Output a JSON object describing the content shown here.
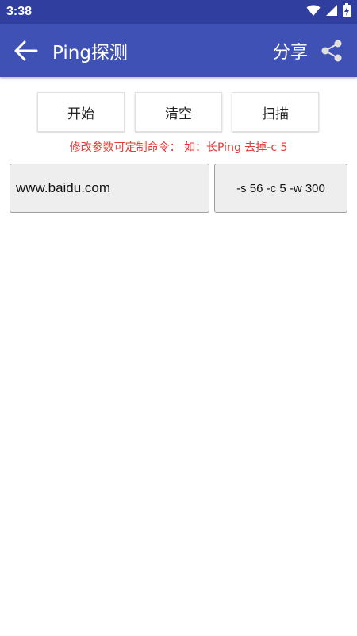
{
  "status_bar": {
    "time": "3:38",
    "icons": [
      "wifi-icon",
      "cellular-signal-icon",
      "battery-charging-icon"
    ]
  },
  "app_bar": {
    "back_icon": "arrow-left-icon",
    "title": "Ping探测",
    "share_label": "分享",
    "share_icon": "share-icon"
  },
  "actions": {
    "start": "开始",
    "clear": "清空",
    "scan": "扫描"
  },
  "hint": "修改参数可定制命令：  如：长Ping 去掉-c 5",
  "inputs": {
    "host_value": "www.baidu.com",
    "params_value": "-s 56 -c 5 -w 300"
  },
  "colors": {
    "status_bar": "#303f9f",
    "app_bar": "#3f51b5",
    "hint_text": "#e53935",
    "field_bg": "#eeeeee"
  }
}
